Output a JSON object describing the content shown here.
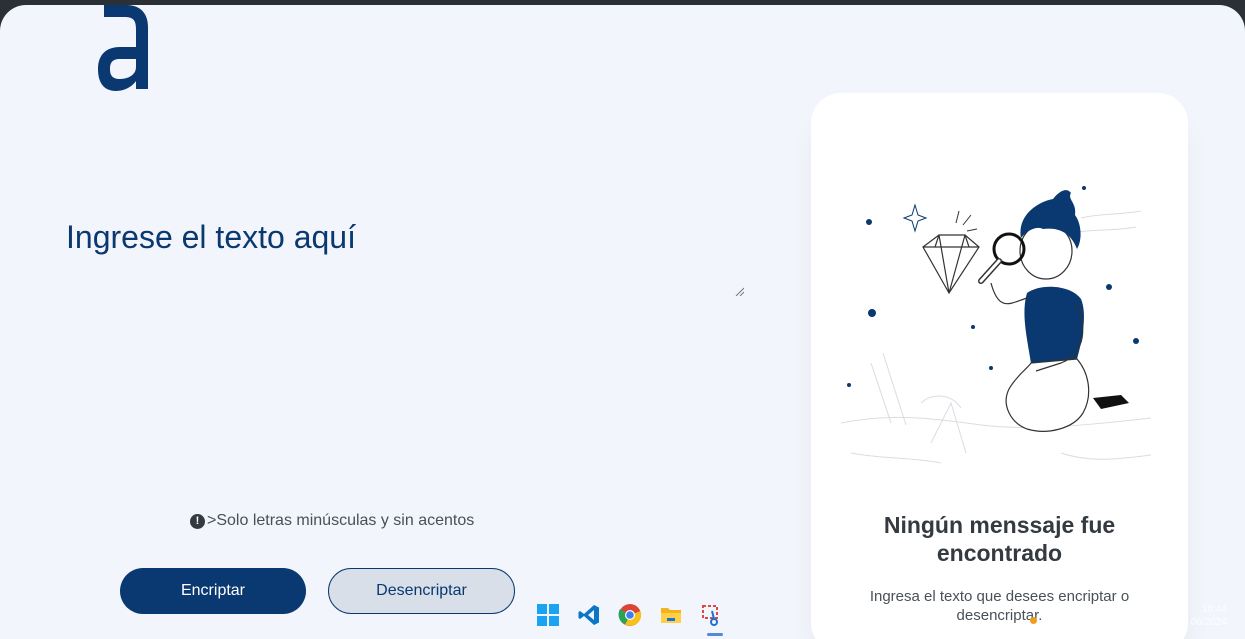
{
  "app": {
    "logo_label": "a"
  },
  "input": {
    "placeholder": "Ingrese el texto aquí",
    "value": ""
  },
  "hint": {
    "icon": "info-icon",
    "text": ">Solo letras minúsculas y sin acentos"
  },
  "buttons": {
    "encrypt_label": "Encriptar",
    "decrypt_label": "Desencriptar"
  },
  "result": {
    "illustration": "person-with-magnifier-illustration",
    "title_line1": "Ningún menssaje fue",
    "title_line2": "encontrado",
    "text": "Ingresa el texto que desees encriptar o desencriptar."
  },
  "taskbar": {
    "icons": [
      "windows-start-icon",
      "vscode-icon",
      "chrome-icon",
      "file-explorer-icon",
      "snipping-tool-icon"
    ]
  },
  "clock": {
    "time": "10:44",
    "date": "06/2024"
  },
  "colors": {
    "primary": "#0a3871",
    "background": "#f3f5fc",
    "card": "#ffffff",
    "text": "#495057"
  }
}
